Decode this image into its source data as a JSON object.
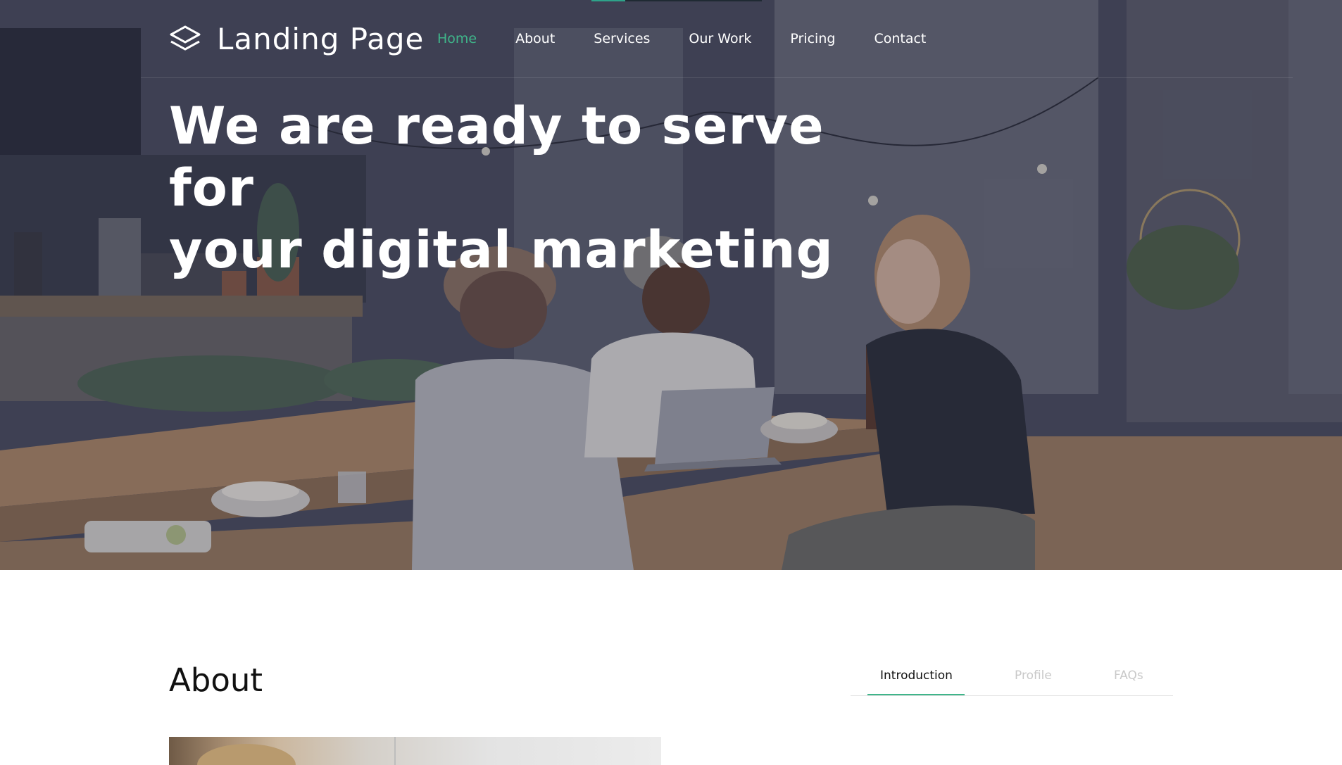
{
  "brand": {
    "name": "Landing Page",
    "logo_icon": "layers-icon",
    "accent_color": "#3fb58a"
  },
  "nav": {
    "items": [
      {
        "label": "Home",
        "active": true
      },
      {
        "label": "About",
        "active": false
      },
      {
        "label": "Services",
        "active": false
      },
      {
        "label": "Our Work",
        "active": false
      },
      {
        "label": "Pricing",
        "active": false
      },
      {
        "label": "Contact",
        "active": false
      }
    ]
  },
  "hero": {
    "headline_line1": "We are ready to serve for",
    "headline_line2": "your digital marketing"
  },
  "about": {
    "title": "About",
    "tabs": [
      {
        "label": "Introduction",
        "active": true
      },
      {
        "label": "Profile",
        "active": false
      },
      {
        "label": "FAQs",
        "active": false
      }
    ]
  }
}
